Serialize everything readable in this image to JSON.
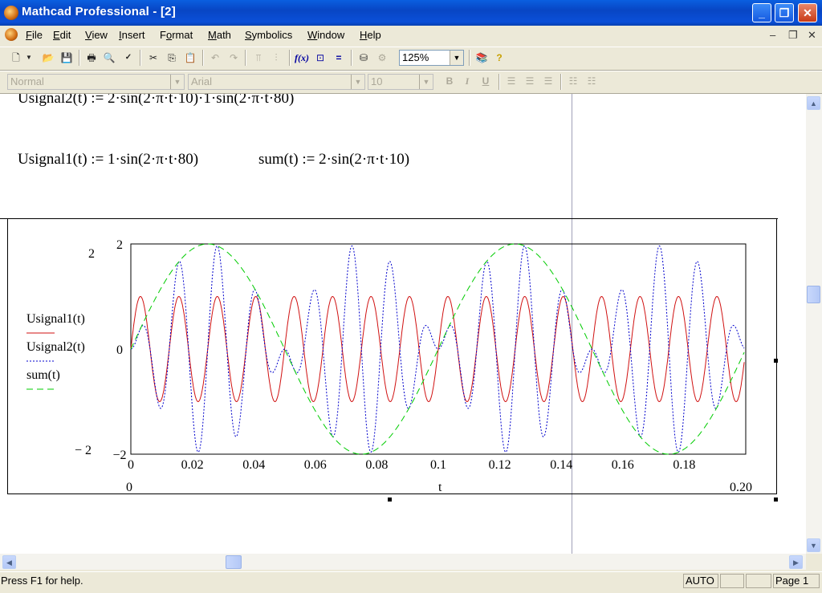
{
  "window": {
    "title": "Mathcad Professional - [2]"
  },
  "menu": [
    {
      "label": "File",
      "key": "F"
    },
    {
      "label": "Edit",
      "key": "E"
    },
    {
      "label": "View",
      "key": "V"
    },
    {
      "label": "Insert",
      "key": "I"
    },
    {
      "label": "Format",
      "key": "o"
    },
    {
      "label": "Math",
      "key": "M"
    },
    {
      "label": "Symbolics",
      "key": "S"
    },
    {
      "label": "Window",
      "key": "W"
    },
    {
      "label": "Help",
      "key": "H"
    }
  ],
  "toolbar": {
    "zoom": "125%",
    "style": "Normal",
    "font": "Arial",
    "size": "10",
    "bold": "B",
    "italic": "I",
    "underline": "U"
  },
  "equations": {
    "usignal2": "Usignal2(t) := 2·sin(2·π·t·10)·1·sin(2·π·t·80)",
    "usignal1": "Usignal1(t) := 1·sin(2·π·t·80)",
    "sum": "sum(t) := 2·sin(2·π·t·10)"
  },
  "chart_data": {
    "type": "line",
    "xlabel": "t",
    "x_range": [
      0,
      0.2
    ],
    "ylim": [
      -2,
      2
    ],
    "x_range_labels": [
      "0",
      "0.20"
    ],
    "y_range_labels": [
      "2",
      "− 2"
    ],
    "yticks": [
      "2",
      "0",
      "-2"
    ],
    "xticks": [
      "0",
      "0.02",
      "0.04",
      "0.06",
      "0.08",
      "0.1",
      "0.12",
      "0.14",
      "0.16",
      "0.18"
    ],
    "legend_position": "left",
    "series": [
      {
        "name": "Usignal1(t)",
        "color": "#d01010",
        "dash": "solid",
        "formula": "1·sin(2·π·t·80)"
      },
      {
        "name": "Usignal2(t)",
        "color": "#0000cc",
        "dash": "dotted",
        "formula": "2·sin(2·π·t·10)·1·sin(2·π·t·80)"
      },
      {
        "name": "sum(t)",
        "color": "#00cc00",
        "dash": "dashed",
        "formula": "2·sin(2·π·t·10)"
      }
    ]
  },
  "status": {
    "help": "Press F1 for help.",
    "mode": "AUTO",
    "page": "Page 1"
  }
}
